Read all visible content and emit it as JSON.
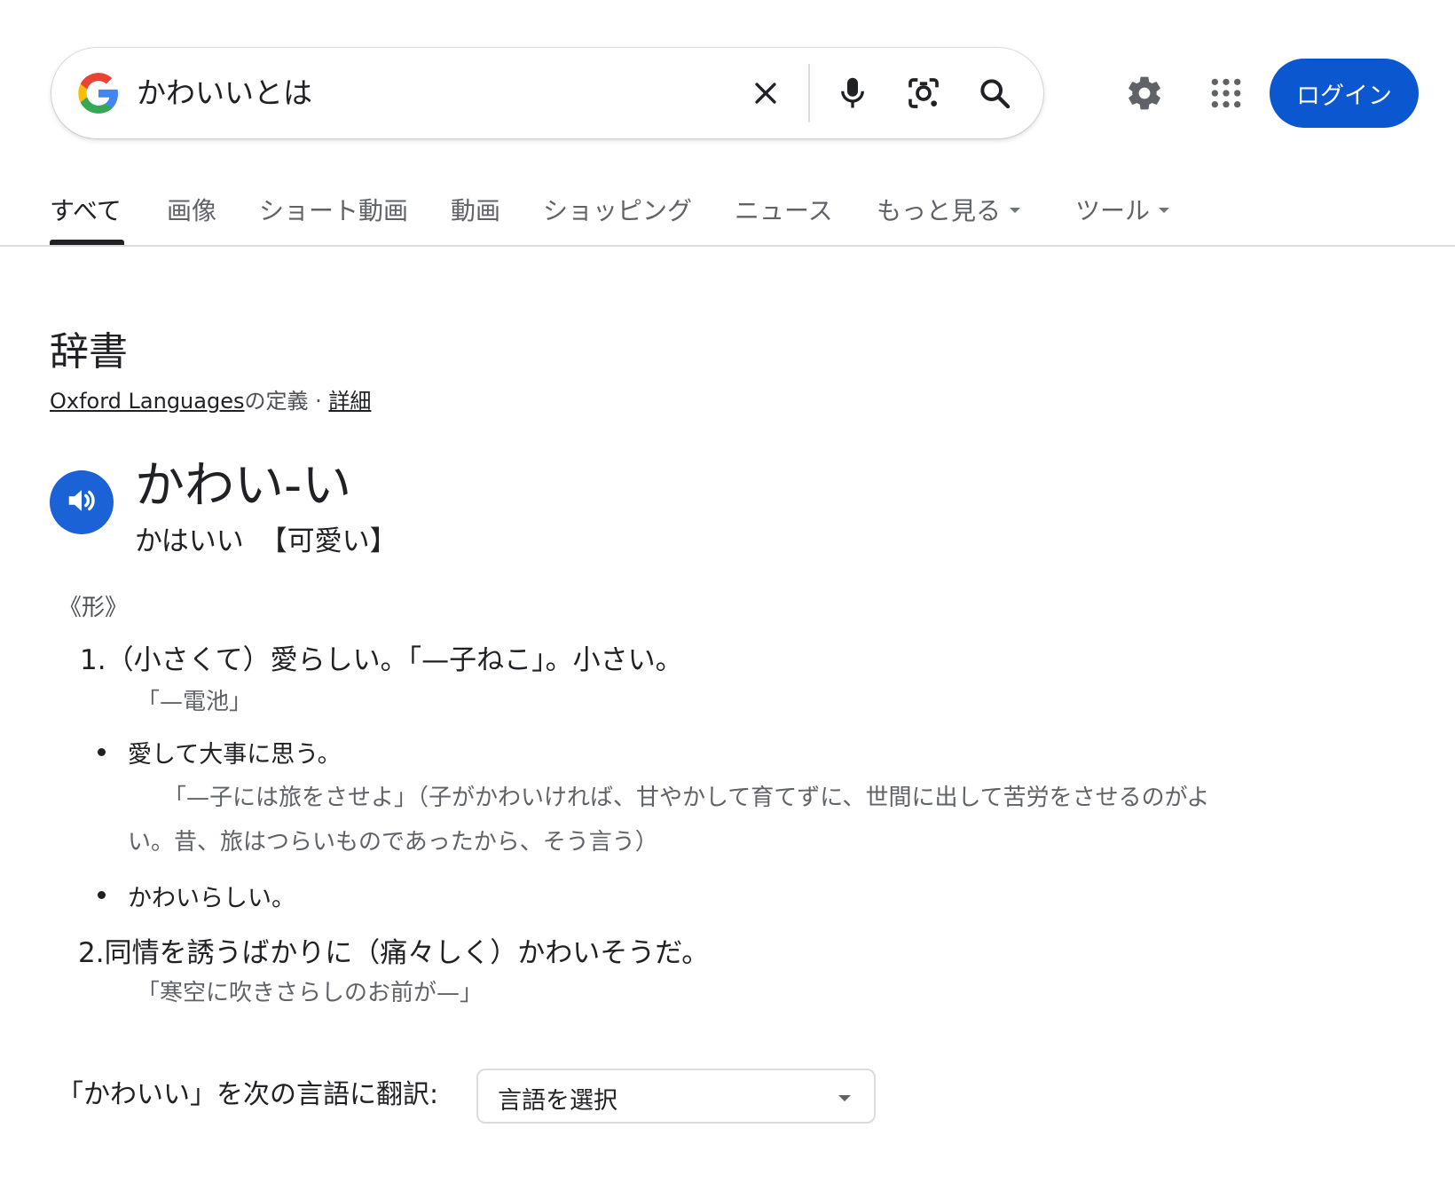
{
  "search": {
    "query": "かわいいとは"
  },
  "header": {
    "login_label": "ログイン"
  },
  "tabs": [
    {
      "label": "すべて",
      "active": true
    },
    {
      "label": "画像"
    },
    {
      "label": "ショート動画"
    },
    {
      "label": "動画"
    },
    {
      "label": "ショッピング"
    },
    {
      "label": "ニュース"
    },
    {
      "label": "もっと見る",
      "dropdown": true
    },
    {
      "label": "ツール",
      "dropdown": true
    }
  ],
  "dictionary": {
    "title": "辞書",
    "source_link": "Oxford Languages",
    "source_suffix": "の定義",
    "separator": "·",
    "details_link": "詳細",
    "headword": "かわい-い",
    "reading": "かはいい 【可愛い】",
    "part_of_speech": "《形》",
    "senses": [
      {
        "text": "1.（小さくて）愛らしい。「—子ねこ」。小さい。",
        "example": "「—電池」",
        "subsenses": [
          {
            "text": "愛して大事に思う。",
            "example": "「—子には旅をさせよ」（子がかわいければ、甘やかして育てずに、世間に出して苦労をさせるのがよい。昔、旅はつらいものであったから、そう言う）"
          },
          {
            "text": "かわいらしい。"
          }
        ]
      },
      {
        "text": "2.同情を誘うばかりに（痛々しく）かわいそうだ。",
        "example": "「寒空に吹きさらしのお前が—」"
      }
    ]
  },
  "translate": {
    "label": "「かわいい」を次の言語に翻訳:",
    "select_value": "言語を選択"
  },
  "colors": {
    "accent": "#0b57d0",
    "speaker": "#1a62d6"
  },
  "icons": [
    "google-g-icon",
    "clear-icon",
    "mic-icon",
    "lens-icon",
    "search-icon",
    "gear-icon",
    "apps-grid-icon",
    "speaker-icon"
  ]
}
